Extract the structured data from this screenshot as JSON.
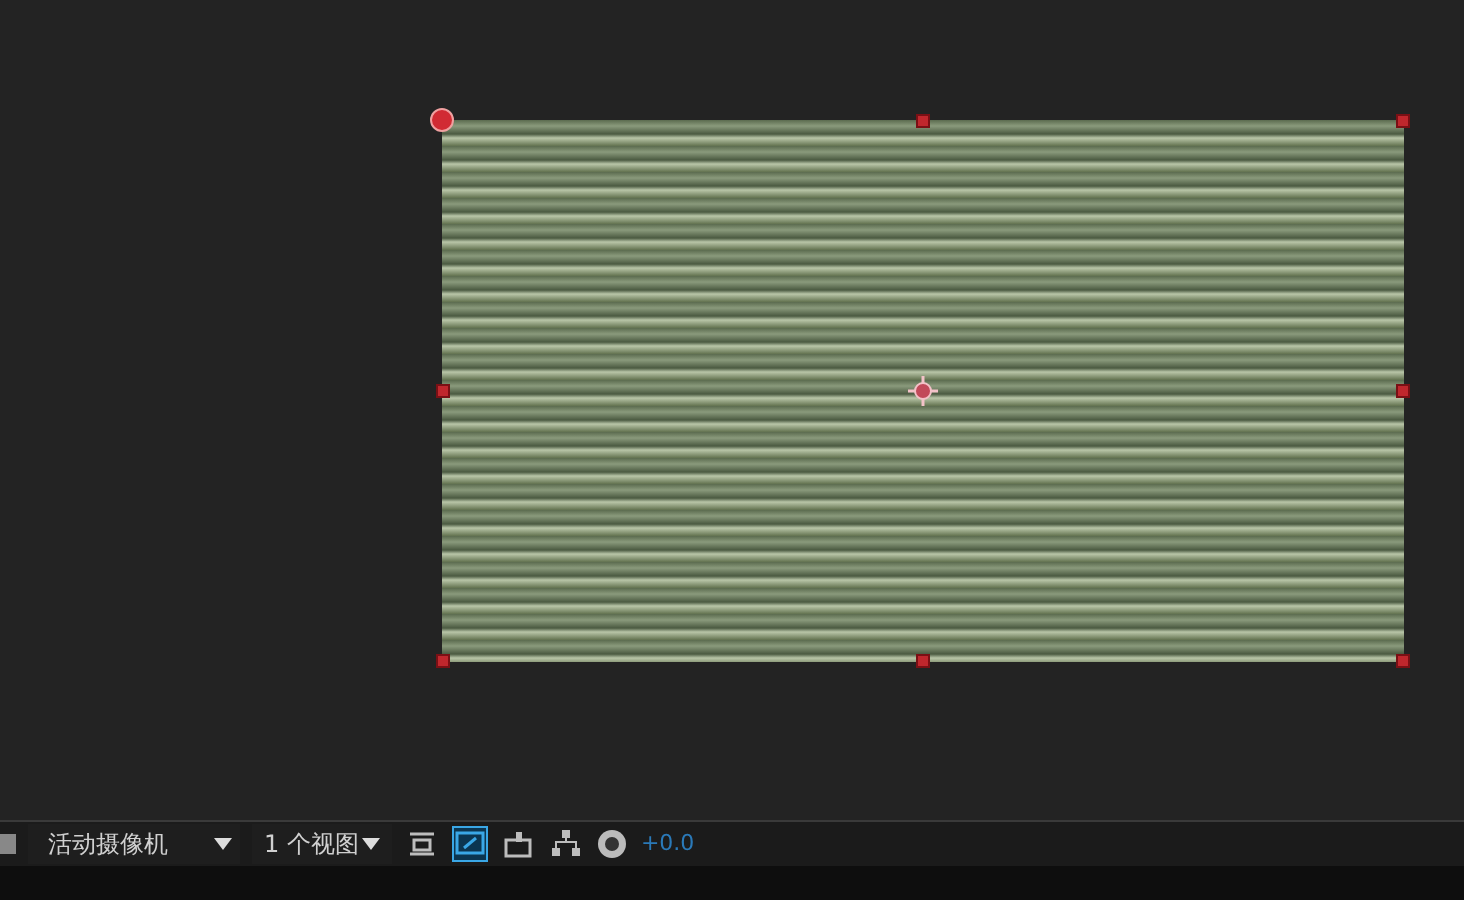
{
  "layer": {
    "selected": true
  },
  "toolbar": {
    "camera": "活动摄像机",
    "views": "1 个视图",
    "toggles": [
      {
        "kind": "fit",
        "on": false
      },
      {
        "kind": "region",
        "on": true
      },
      {
        "kind": "comp",
        "on": false
      },
      {
        "kind": "flow",
        "on": false
      }
    ],
    "exposure": "+0.0"
  }
}
